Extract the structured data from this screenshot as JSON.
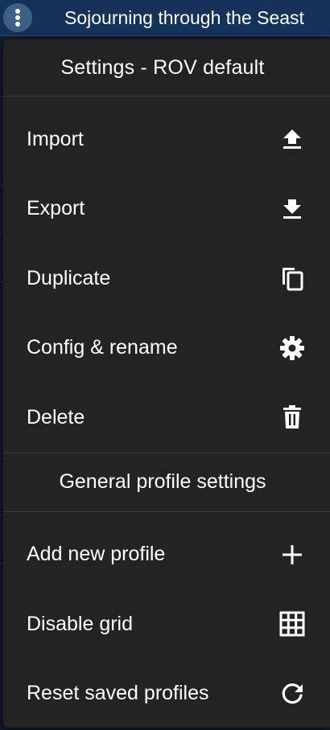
{
  "app": {
    "title": "Sojourning through the Seast"
  },
  "menu": {
    "title": "Settings - ROV default",
    "profile_items": [
      {
        "label": "Import",
        "icon": "upload-icon"
      },
      {
        "label": "Export",
        "icon": "download-icon"
      },
      {
        "label": "Duplicate",
        "icon": "copy-icon"
      },
      {
        "label": "Config & rename",
        "icon": "gear-icon"
      },
      {
        "label": "Delete",
        "icon": "trash-icon"
      }
    ],
    "general_section_title": "General profile settings",
    "general_items": [
      {
        "label": "Add new profile",
        "icon": "plus-icon"
      },
      {
        "label": "Disable grid",
        "icon": "grid-icon"
      },
      {
        "label": "Reset saved profiles",
        "icon": "refresh-icon"
      }
    ]
  },
  "colors": {
    "menu_background": "#232323",
    "topbar_background": "#14325a",
    "text": "#ffffff"
  }
}
